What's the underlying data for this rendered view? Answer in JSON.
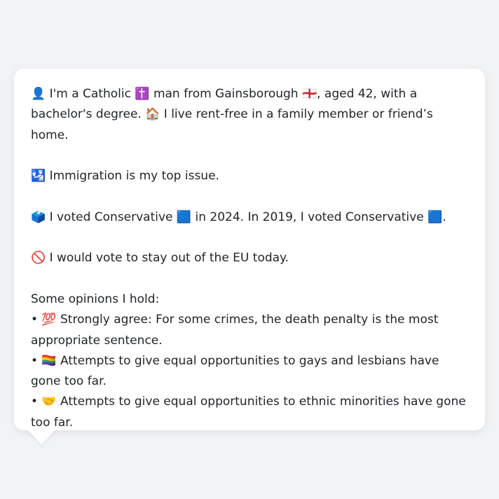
{
  "persona": {
    "intro": "👤 I'm a Catholic ✝️ man from Gainsborough 🏴󠁧󠁢󠁥󠁮󠁧󠁿, aged 42, with a bachelor's degree. 🏠 I live rent-free in a family member or friend’s home.",
    "top_issue": "🛂 Immigration is my top issue.",
    "votes": "🗳️ I voted Conservative 🟦 in 2024. In 2019, I voted Conservative 🟦.",
    "eu": "🚫 I would vote to stay out of the EU today.",
    "opinions_heading": "Some opinions I hold:",
    "opinions": [
      "• 💯 Strongly agree: For some crimes, the death penalty is the most appropriate sentence.",
      "• 🏳️‍🌈 Attempts to give equal opportunities to gays and lesbians have gone too far.",
      "• 🤝 Attempts to give equal opportunities to ethnic minorities have gone too far."
    ]
  }
}
